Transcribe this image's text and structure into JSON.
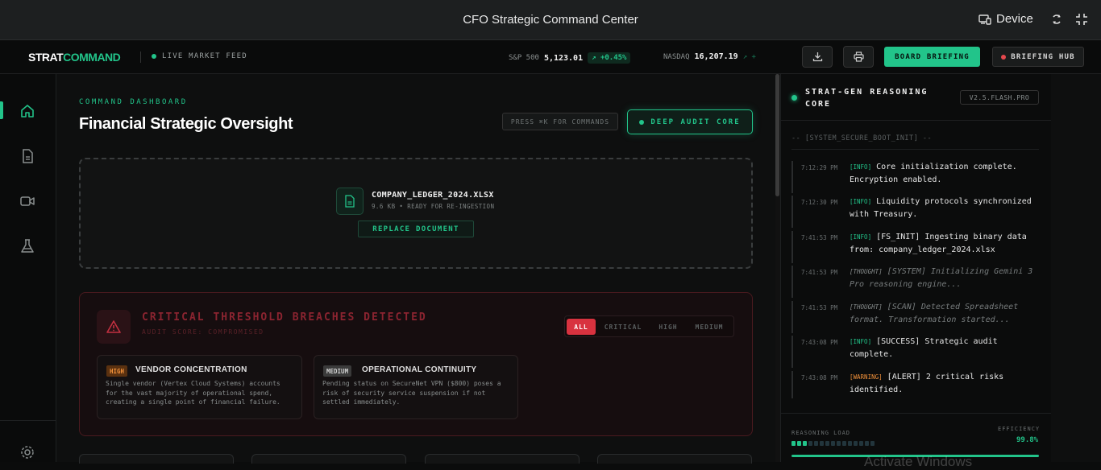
{
  "window": {
    "title": "CFO Strategic Command Center",
    "device_label": "Device"
  },
  "nav": {
    "logo_a": "STRAT",
    "logo_b": "COMMAND",
    "live_feed": "LIVE MARKET FEED",
    "sp_label": "S&P 500",
    "sp_value": "5,123.01",
    "sp_change": "+0.45%",
    "nasdaq_label": "NASDAQ",
    "nasdaq_value": "16,207.19",
    "nasdaq_change": "+",
    "board_briefing": "BOARD BRIEFING",
    "briefing_hub": "BRIEFING HUB"
  },
  "sidebar": {
    "items": [
      "home-icon",
      "document-icon",
      "video-icon",
      "flask-icon"
    ],
    "footer": "gear-icon"
  },
  "main": {
    "eyebrow": "COMMAND DASHBOARD",
    "title": "Financial Strategic Oversight",
    "cmdk": "PRESS ⌘K FOR COMMANDS",
    "audit_button": "DEEP AUDIT CORE",
    "file": {
      "name": "COMPANY_LEDGER_2024.XLSX",
      "meta": "9.6 KB • READY FOR RE-INGESTION",
      "replace": "REPLACE DOCUMENT"
    },
    "alert": {
      "title": "CRITICAL THRESHOLD BREACHES DETECTED",
      "subtitle": "AUDIT SCORE: COMPROMISED",
      "filters": [
        "ALL",
        "CRITICAL",
        "HIGH",
        "MEDIUM"
      ],
      "cards": [
        {
          "badge": "HIGH",
          "title": "VENDOR CONCENTRATION",
          "body": "Single vendor (Vertex Cloud Systems) accounts for the vast majority of operational spend, creating a single point of financial failure."
        },
        {
          "badge": "MEDIUM",
          "title": "OPERATIONAL CONTINUITY",
          "body": "Pending status on SecureNet VPN ($800) poses a risk of security service suspension if not settled immediately."
        }
      ]
    }
  },
  "panel": {
    "title_1": "STRAT-GEN REASONING",
    "title_2": "CORE",
    "version": "V2.5.FLASH.PRO",
    "boot": "-- [SYSTEM_SECURE_BOOT_INIT] --",
    "logs": [
      {
        "time": "7:12:29 PM",
        "tag": "[INFO]",
        "text": "Core initialization complete. Encryption enabled."
      },
      {
        "time": "7:12:30 PM",
        "tag": "[INFO]",
        "text": "Liquidity protocols synchronized with Treasury."
      },
      {
        "time": "7:41:53 PM",
        "tag": "[INFO]",
        "text": "[FS_INIT] Ingesting binary data from: company_ledger_2024.xlsx"
      },
      {
        "time": "7:41:53 PM",
        "tag": "[THOUGHT]",
        "text": "[SYSTEM] Initializing Gemini 3 Pro reasoning engine..."
      },
      {
        "time": "7:41:53 PM",
        "tag": "[THOUGHT]",
        "text": "[SCAN] Detected Spreadsheet format. Transformation started..."
      },
      {
        "time": "7:43:08 PM",
        "tag": "[INFO]",
        "text": "[SUCCESS] Strategic audit complete."
      },
      {
        "time": "7:43:08 PM",
        "tag": "[WARNING]",
        "text": "[ALERT] 2 critical risks identified."
      }
    ],
    "reasoning_load": "REASONING LOAD",
    "load_level": 0.2,
    "efficiency_label": "EFFICIENCY",
    "efficiency": "99.8%",
    "watermark": "Activate Windows"
  },
  "colors": {
    "accent": "#22c48a",
    "danger": "#d8323f",
    "warning": "#f2913a"
  }
}
